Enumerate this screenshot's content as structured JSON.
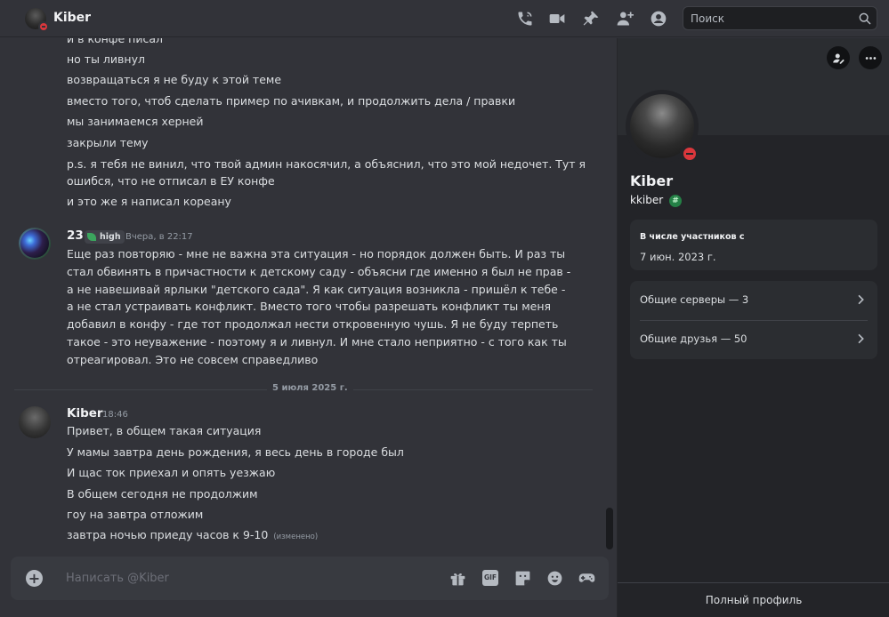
{
  "header": {
    "title": "Kiber",
    "search_placeholder": "Поиск",
    "icons": [
      "call-icon",
      "video-icon",
      "pin-icon",
      "add-friend-icon",
      "profile-toggle-icon",
      "search-icon"
    ]
  },
  "messages": {
    "continuation_lines": [
      "и в конфе писал",
      "но ты ливнул",
      "возвращаться я не буду к этой теме",
      "вместо того, чтоб сделать пример по ачивкам, и продолжить дела / правки",
      "мы занимаемся херней",
      "закрыли тему",
      "p.s. я тебя не винил, что твой админ накосячил, а объяснил, что это мой недочет. Тут я",
      "ошибся, что не отписал в ЕУ конфе",
      "и это же я написал кореану"
    ],
    "msg_23": {
      "author": "23",
      "tag": "high",
      "timestamp": "Вчера, в 22:17",
      "text": "Еще раз повторяю - мне не важна эта ситуация - но порядок должен быть. И раз ты стал обвинять в причастности к детскому саду - объясни где именно я был не прав - а не навешивай ярлыки \"детского сада\". Я как ситуация возникла - пришёл к тебе - а не стал устраивать конфликт. Вместо того чтобы разрешать конфликт ты меня добавил в конфу - где тот продолжал нести откровенную чушь. Я не буду терпеть такое - это неуважение - поэтому я и ливнул. И мне стало неприятно - с того как ты отреагировал. Это не совсем справедливо"
    },
    "date_divider": "5 июля 2025 г.",
    "msg_kiber": {
      "author": "Kiber",
      "timestamp": "18:46",
      "lines": [
        "Привет, в общем такая ситуация",
        "У мамы завтра день рождения, я весь день в городе был",
        "И щас ток приехал и опять уезжаю",
        "В общем сегодня не продолжим",
        "гоу на завтра отложим",
        "завтра ночью приеду часов к 9-10"
      ],
      "edited_label": "(изменено)"
    }
  },
  "composer": {
    "placeholder": "Написать @Kiber",
    "gif_label": "GIF",
    "icons": [
      "add-attachment-icon",
      "gift-icon",
      "gif-icon",
      "sticker-icon",
      "emoji-icon",
      "activity-icon"
    ]
  },
  "profile": {
    "name": "Kiber",
    "username": "kkiber",
    "member_since_label": "В числе участников с",
    "member_since_value": "7 июн. 2023 г.",
    "mutual_servers": "Общие серверы — 3",
    "mutual_friends": "Общие друзья — 50",
    "full_profile": "Полный профиль",
    "status_color": "#da373c"
  }
}
